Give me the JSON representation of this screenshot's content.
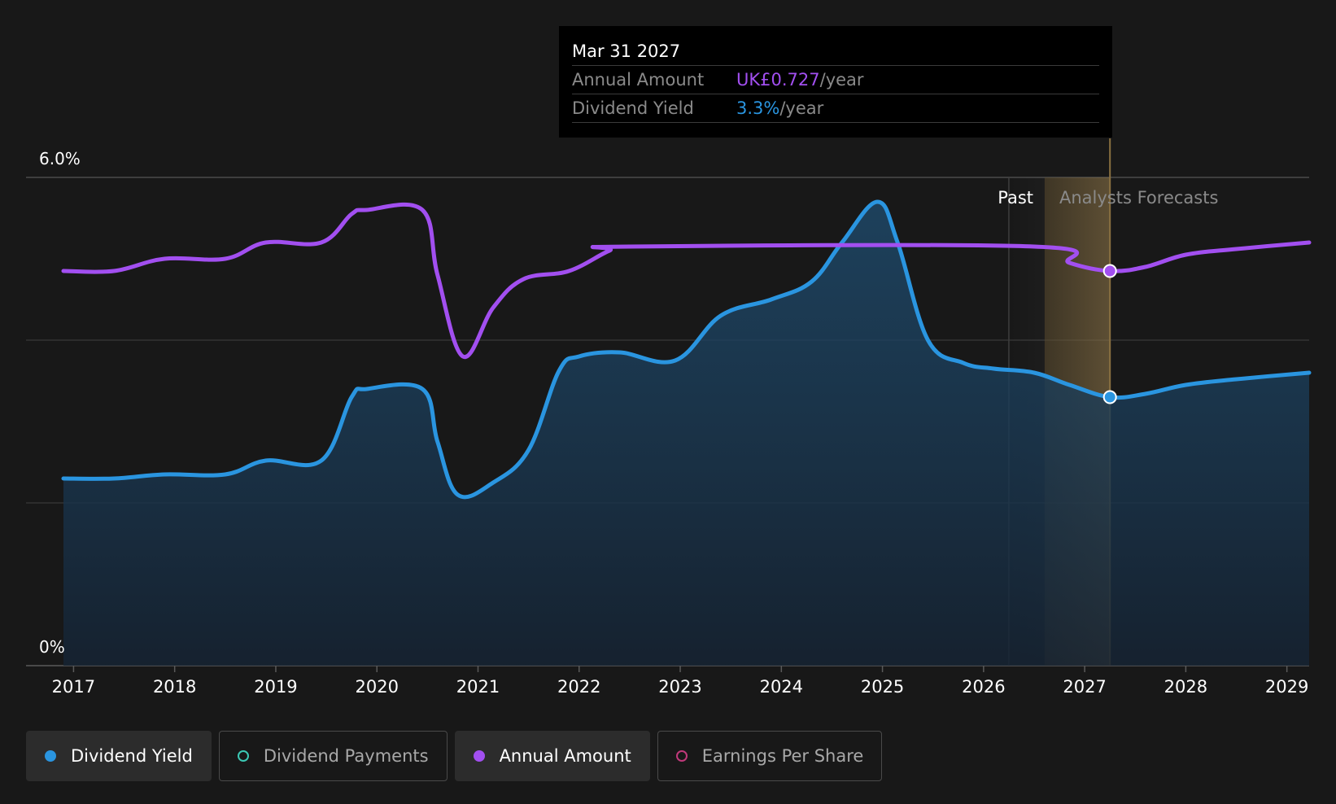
{
  "tooltip": {
    "date": "Mar 31 2027",
    "rows": [
      {
        "label": "Annual Amount",
        "value": "UK£0.727",
        "unit": "/year",
        "color": "#a24ff0"
      },
      {
        "label": "Dividend Yield",
        "value": "3.3%",
        "unit": "/year",
        "color": "#2a95e0"
      }
    ]
  },
  "regions": {
    "past": "Past",
    "forecast": "Analysts Forecasts"
  },
  "legend": [
    {
      "label": "Dividend Yield",
      "color": "#2a95e0",
      "active": true,
      "filled": true
    },
    {
      "label": "Dividend Payments",
      "color": "#3cc8b4",
      "active": false,
      "filled": false
    },
    {
      "label": "Annual Amount",
      "color": "#a24ff0",
      "active": true,
      "filled": true
    },
    {
      "label": "Earnings Per Share",
      "color": "#c0397a",
      "active": false,
      "filled": false
    }
  ],
  "chart_data": {
    "type": "line",
    "y_tick_labels": [
      "6.0%",
      "0%"
    ],
    "ylim": [
      0,
      6
    ],
    "xlim": [
      2016.53,
      2029.22
    ],
    "x_tick_labels": [
      "2017",
      "2018",
      "2019",
      "2020",
      "2021",
      "2022",
      "2023",
      "2024",
      "2025",
      "2026",
      "2027",
      "2028",
      "2029"
    ],
    "past_end": 2026.25,
    "highlight_x": 2027.25,
    "series": [
      {
        "name": "Dividend Yield",
        "color": "#2a95e0",
        "filled": true,
        "points": [
          [
            2016.9,
            2.3
          ],
          [
            2017.4,
            2.3
          ],
          [
            2017.9,
            2.35
          ],
          [
            2018.5,
            2.35
          ],
          [
            2018.9,
            2.52
          ],
          [
            2019.45,
            2.52
          ],
          [
            2019.75,
            3.3
          ],
          [
            2019.9,
            3.4
          ],
          [
            2020.45,
            3.4
          ],
          [
            2020.6,
            2.75
          ],
          [
            2020.8,
            2.1
          ],
          [
            2021.15,
            2.25
          ],
          [
            2021.5,
            2.65
          ],
          [
            2021.8,
            3.62
          ],
          [
            2022.0,
            3.8
          ],
          [
            2022.4,
            3.85
          ],
          [
            2022.95,
            3.75
          ],
          [
            2023.4,
            4.3
          ],
          [
            2023.9,
            4.5
          ],
          [
            2024.3,
            4.72
          ],
          [
            2024.6,
            5.2
          ],
          [
            2024.95,
            5.7
          ],
          [
            2025.15,
            5.2
          ],
          [
            2025.45,
            4.0
          ],
          [
            2025.8,
            3.72
          ],
          [
            2026.1,
            3.65
          ],
          [
            2026.5,
            3.6
          ],
          [
            2026.85,
            3.45
          ],
          [
            2027.25,
            3.3
          ],
          [
            2027.6,
            3.34
          ],
          [
            2028.0,
            3.45
          ],
          [
            2028.5,
            3.52
          ],
          [
            2029.22,
            3.6
          ]
        ]
      },
      {
        "name": "Annual Amount",
        "color": "#a24ff0",
        "filled": false,
        "points": [
          [
            2016.9,
            4.85
          ],
          [
            2017.4,
            4.85
          ],
          [
            2017.9,
            5.0
          ],
          [
            2018.5,
            5.0
          ],
          [
            2018.9,
            5.2
          ],
          [
            2019.45,
            5.2
          ],
          [
            2019.75,
            5.55
          ],
          [
            2019.9,
            5.6
          ],
          [
            2020.45,
            5.6
          ],
          [
            2020.6,
            4.8
          ],
          [
            2020.85,
            3.8
          ],
          [
            2021.15,
            4.4
          ],
          [
            2021.45,
            4.75
          ],
          [
            2021.9,
            4.85
          ],
          [
            2022.3,
            5.1
          ],
          [
            2022.5,
            5.15
          ],
          [
            2026.5,
            5.15
          ],
          [
            2026.85,
            4.95
          ],
          [
            2027.25,
            4.85
          ],
          [
            2027.6,
            4.9
          ],
          [
            2028.0,
            5.05
          ],
          [
            2028.5,
            5.12
          ],
          [
            2029.22,
            5.2
          ]
        ]
      }
    ]
  }
}
